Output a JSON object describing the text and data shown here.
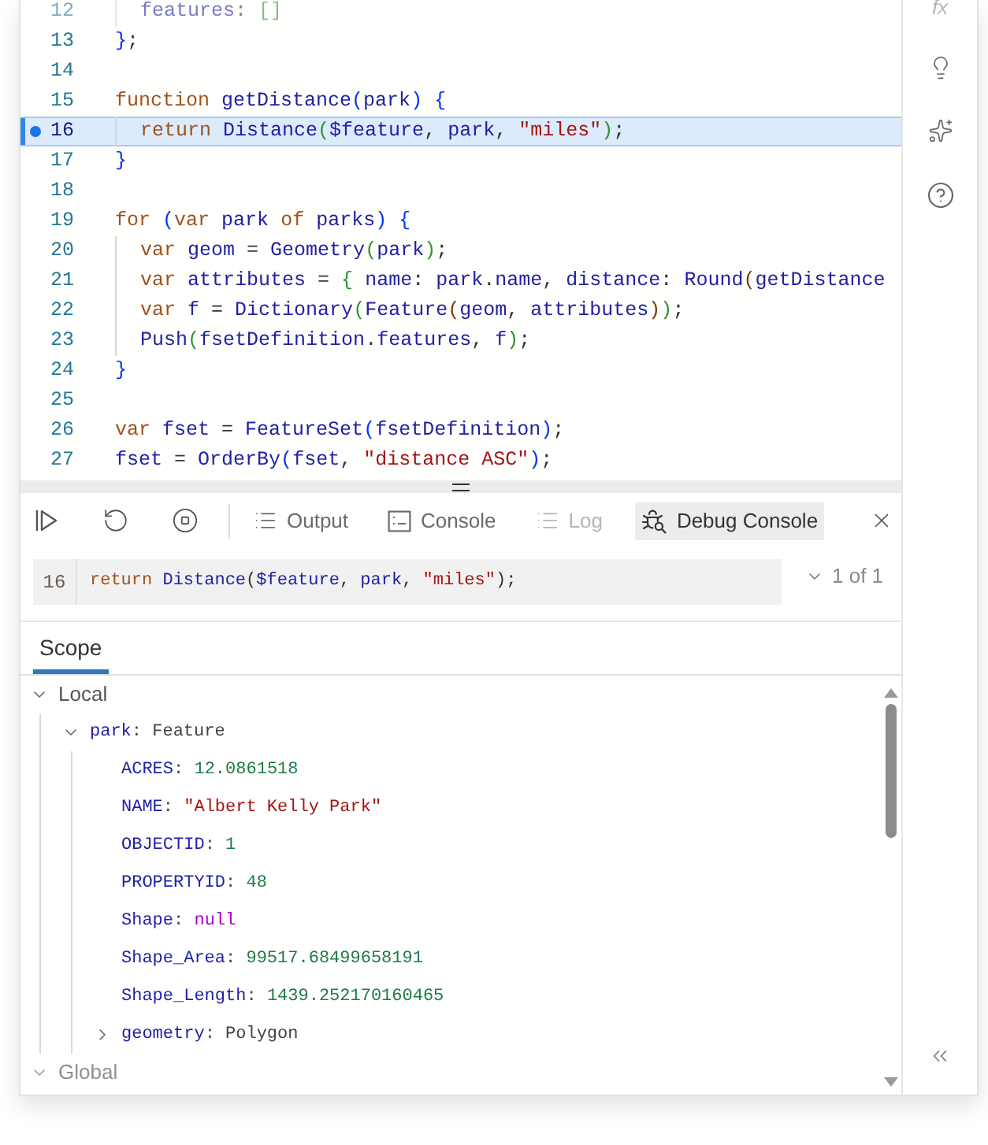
{
  "editor": {
    "lines": [
      {
        "number": "12",
        "selected": false,
        "breakpoint": false,
        "faded": true,
        "indented": true,
        "tokens": [
          {
            "text": "features",
            "kind": "name"
          },
          {
            "text": ": ",
            "kind": "punct"
          },
          {
            "text": "[]",
            "kind": "bracket2"
          }
        ]
      },
      {
        "number": "13",
        "selected": false,
        "breakpoint": false,
        "faded": false,
        "indented": false,
        "tokens": [
          {
            "text": "}",
            "kind": "bracket1"
          },
          {
            "text": ";",
            "kind": "punct"
          }
        ]
      },
      {
        "number": "14",
        "selected": false,
        "breakpoint": false,
        "faded": false,
        "indented": false
      },
      {
        "number": "15",
        "selected": false,
        "breakpoint": false,
        "faded": false,
        "indented": false,
        "tokens": [
          {
            "text": "function ",
            "kind": "keyword"
          },
          {
            "text": "getDistance",
            "kind": "name"
          },
          {
            "text": "(",
            "kind": "bracket1"
          },
          {
            "text": "park",
            "kind": "name"
          },
          {
            "text": ")",
            "kind": "bracket1"
          },
          {
            "text": " {",
            "kind": "bracket1"
          }
        ]
      },
      {
        "number": "16",
        "selected": true,
        "breakpoint": true,
        "faded": false,
        "indented": true,
        "tokens": [
          {
            "text": "return ",
            "kind": "keyword"
          },
          {
            "text": "Distance",
            "kind": "name"
          },
          {
            "text": "(",
            "kind": "bracket2"
          },
          {
            "text": "$feature",
            "kind": "name"
          },
          {
            "text": ", ",
            "kind": "punct"
          },
          {
            "text": "park",
            "kind": "name"
          },
          {
            "text": ", ",
            "kind": "punct"
          },
          {
            "text": "\"miles\"",
            "kind": "string"
          },
          {
            "text": ")",
            "kind": "bracket2"
          },
          {
            "text": ";",
            "kind": "punct"
          }
        ]
      },
      {
        "number": "17",
        "selected": false,
        "breakpoint": false,
        "faded": false,
        "indented": false,
        "tokens": [
          {
            "text": "}",
            "kind": "bracket1"
          }
        ]
      },
      {
        "number": "18",
        "selected": false,
        "breakpoint": false,
        "faded": false,
        "indented": false
      },
      {
        "number": "19",
        "selected": false,
        "breakpoint": false,
        "faded": false,
        "indented": false,
        "tokens": [
          {
            "text": "for ",
            "kind": "keyword"
          },
          {
            "text": "(",
            "kind": "bracket1"
          },
          {
            "text": "var ",
            "kind": "keyword"
          },
          {
            "text": "park ",
            "kind": "name"
          },
          {
            "text": "of ",
            "kind": "keyword"
          },
          {
            "text": "parks",
            "kind": "name"
          },
          {
            "text": ")",
            "kind": "bracket1"
          },
          {
            "text": " {",
            "kind": "bracket1"
          }
        ]
      },
      {
        "number": "20",
        "selected": false,
        "breakpoint": false,
        "faded": false,
        "indented": true,
        "tokens": [
          {
            "text": "var ",
            "kind": "keyword"
          },
          {
            "text": "geom ",
            "kind": "name"
          },
          {
            "text": "= ",
            "kind": "punct"
          },
          {
            "text": "Geometry",
            "kind": "name"
          },
          {
            "text": "(",
            "kind": "bracket2"
          },
          {
            "text": "park",
            "kind": "name"
          },
          {
            "text": ")",
            "kind": "bracket2"
          },
          {
            "text": ";",
            "kind": "punct"
          }
        ]
      },
      {
        "number": "21",
        "selected": false,
        "breakpoint": false,
        "faded": false,
        "indented": true,
        "tokens": [
          {
            "text": "var ",
            "kind": "keyword"
          },
          {
            "text": "attributes ",
            "kind": "name"
          },
          {
            "text": "= ",
            "kind": "punct"
          },
          {
            "text": "{ ",
            "kind": "bracket2"
          },
          {
            "text": "name",
            "kind": "name"
          },
          {
            "text": ": ",
            "kind": "punct"
          },
          {
            "text": "park",
            "kind": "name"
          },
          {
            "text": ".",
            "kind": "punct"
          },
          {
            "text": "name",
            "kind": "name"
          },
          {
            "text": ", ",
            "kind": "punct"
          },
          {
            "text": "distance",
            "kind": "name"
          },
          {
            "text": ": ",
            "kind": "punct"
          },
          {
            "text": "Round",
            "kind": "name"
          },
          {
            "text": "(",
            "kind": "bracket3"
          },
          {
            "text": "getDistance",
            "kind": "name"
          }
        ]
      },
      {
        "number": "22",
        "selected": false,
        "breakpoint": false,
        "faded": false,
        "indented": true,
        "tokens": [
          {
            "text": "var ",
            "kind": "keyword"
          },
          {
            "text": "f ",
            "kind": "name"
          },
          {
            "text": "= ",
            "kind": "punct"
          },
          {
            "text": "Dictionary",
            "kind": "name"
          },
          {
            "text": "(",
            "kind": "bracket2"
          },
          {
            "text": "Feature",
            "kind": "name"
          },
          {
            "text": "(",
            "kind": "bracket3"
          },
          {
            "text": "geom",
            "kind": "name"
          },
          {
            "text": ", ",
            "kind": "punct"
          },
          {
            "text": "attributes",
            "kind": "name"
          },
          {
            "text": ")",
            "kind": "bracket3"
          },
          {
            "text": ")",
            "kind": "bracket2"
          },
          {
            "text": ";",
            "kind": "punct"
          }
        ]
      },
      {
        "number": "23",
        "selected": false,
        "breakpoint": false,
        "faded": false,
        "indented": true,
        "tokens": [
          {
            "text": "Push",
            "kind": "name"
          },
          {
            "text": "(",
            "kind": "bracket2"
          },
          {
            "text": "fsetDefinition",
            "kind": "name"
          },
          {
            "text": ".",
            "kind": "punct"
          },
          {
            "text": "features",
            "kind": "name"
          },
          {
            "text": ", ",
            "kind": "punct"
          },
          {
            "text": "f",
            "kind": "name"
          },
          {
            "text": ")",
            "kind": "bracket2"
          },
          {
            "text": ";",
            "kind": "punct"
          }
        ]
      },
      {
        "number": "24",
        "selected": false,
        "breakpoint": false,
        "faded": false,
        "indented": false,
        "tokens": [
          {
            "text": "}",
            "kind": "bracket1"
          }
        ]
      },
      {
        "number": "25",
        "selected": false,
        "breakpoint": false,
        "faded": false,
        "indented": false
      },
      {
        "number": "26",
        "selected": false,
        "breakpoint": false,
        "faded": false,
        "indented": false,
        "tokens": [
          {
            "text": "var ",
            "kind": "keyword"
          },
          {
            "text": "fset ",
            "kind": "name"
          },
          {
            "text": "= ",
            "kind": "punct"
          },
          {
            "text": "FeatureSet",
            "kind": "name"
          },
          {
            "text": "(",
            "kind": "bracket1"
          },
          {
            "text": "fsetDefinition",
            "kind": "name"
          },
          {
            "text": ")",
            "kind": "bracket1"
          },
          {
            "text": ";",
            "kind": "punct"
          }
        ]
      },
      {
        "number": "27",
        "selected": false,
        "breakpoint": false,
        "faded": false,
        "indented": false,
        "tokens": [
          {
            "text": "fset ",
            "kind": "name"
          },
          {
            "text": "= ",
            "kind": "punct"
          },
          {
            "text": "OrderBy",
            "kind": "name"
          },
          {
            "text": "(",
            "kind": "bracket1"
          },
          {
            "text": "fset",
            "kind": "name"
          },
          {
            "text": ", ",
            "kind": "punct"
          },
          {
            "text": "\"distance ASC\"",
            "kind": "string"
          },
          {
            "text": ")",
            "kind": "bracket1"
          },
          {
            "text": ";",
            "kind": "punct"
          }
        ]
      }
    ]
  },
  "sidebar": {
    "function_label": "fx"
  },
  "debug_panel": {
    "tabs": [
      {
        "label": "Output",
        "kind": "output",
        "selected": false,
        "disabled": false
      },
      {
        "label": "Console",
        "kind": "console",
        "selected": false,
        "disabled": false
      },
      {
        "label": "Log",
        "kind": "log",
        "selected": false,
        "disabled": true
      },
      {
        "label": "Debug Console",
        "kind": "debug",
        "selected": true,
        "disabled": false
      }
    ],
    "frame": {
      "line": "16",
      "tokens": [
        {
          "text": "return ",
          "kind": "keyword"
        },
        {
          "text": "Distance",
          "kind": "name"
        },
        {
          "text": "(",
          "kind": "punct"
        },
        {
          "text": "$feature",
          "kind": "name"
        },
        {
          "text": ", ",
          "kind": "punct"
        },
        {
          "text": "park",
          "kind": "name"
        },
        {
          "text": ", ",
          "kind": "punct"
        },
        {
          "text": "\"miles\"",
          "kind": "string"
        },
        {
          "text": ");",
          "kind": "punct"
        }
      ],
      "position": "1 of 1"
    },
    "scope_tabs": [
      {
        "label": "Scope",
        "selected": true
      }
    ],
    "scope_tree": [
      {
        "label": "Local",
        "expanded": true,
        "faded": false,
        "children": [
          {
            "name": "park",
            "separator": ":",
            "value": "Feature",
            "kind": "object",
            "expanded": true,
            "children": [
              {
                "name": "ACRES",
                "separator": ":",
                "value": "12.0861518",
                "kind": "number"
              },
              {
                "name": "NAME",
                "separator": ":",
                "value": "\"Albert Kelly Park\"",
                "kind": "string"
              },
              {
                "name": "OBJECTID",
                "separator": ":",
                "value": "1",
                "kind": "number"
              },
              {
                "name": "PROPERTYID",
                "separator": ":",
                "value": "48",
                "kind": "number"
              },
              {
                "name": "Shape",
                "separator": ":",
                "value": "null",
                "kind": "null"
              },
              {
                "name": "Shape_Area",
                "separator": ":",
                "value": "99517.68499658191",
                "kind": "number"
              },
              {
                "name": "Shape_Length",
                "separator": ":",
                "value": "1439.252170160465",
                "kind": "number"
              },
              {
                "name": "geometry",
                "separator": ":",
                "value": "Polygon",
                "kind": "object",
                "expanded": false
              }
            ]
          }
        ]
      },
      {
        "label": "Global",
        "expanded": true,
        "faded": true
      }
    ]
  }
}
